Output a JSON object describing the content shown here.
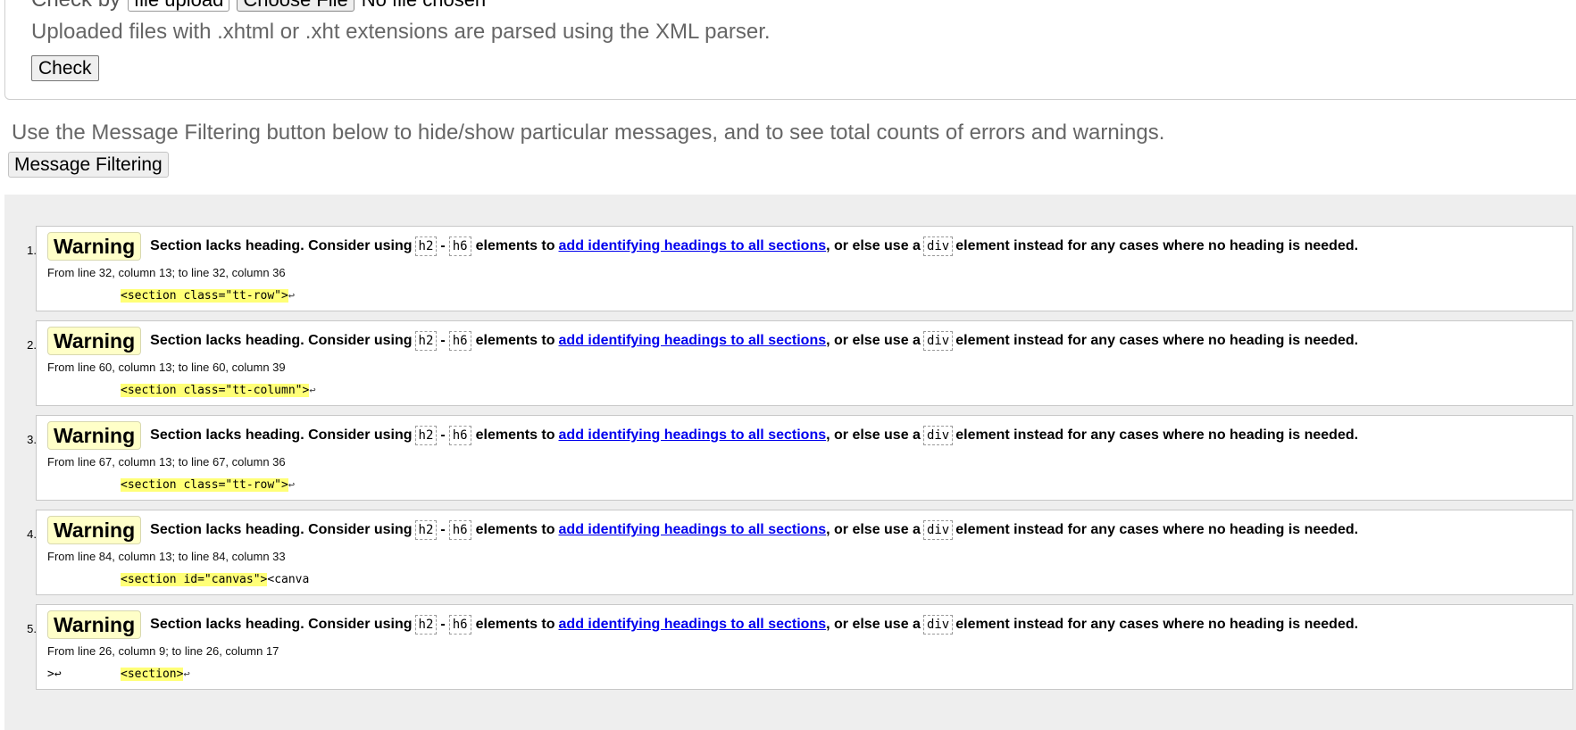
{
  "form": {
    "check_by_label": "Check by",
    "check_by_value": "file upload",
    "choose_file_label": "Choose File",
    "no_file_text": "No file chosen",
    "upload_note": "Uploaded files with .xhtml or .xht extensions are parsed using the XML parser.",
    "check_button": "Check"
  },
  "filter": {
    "note": "Use the Message Filtering button below to hide/show particular messages, and to see total counts of errors and warnings.",
    "button": "Message Filtering"
  },
  "message_text": {
    "prefix": "Section lacks heading. Consider using",
    "code_h2": "h2",
    "dash": "-",
    "code_h6": "h6",
    "middle": "elements to",
    "link": "add identifying headings to all sections",
    "after_link": ", or else use a",
    "code_div": "div",
    "suffix": "element instead for any cases where no heading is needed."
  },
  "messages": [
    {
      "num": "1.",
      "badge": "Warning",
      "location": "From line 32, column 13; to line 32, column 36",
      "pre": "",
      "highlight": "<section class=\"tt-row\">",
      "post": "",
      "lf": "↩"
    },
    {
      "num": "2.",
      "badge": "Warning",
      "location": "From line 60, column 13; to line 60, column 39",
      "pre": "",
      "highlight": "<section class=\"tt-column\">",
      "post": "",
      "lf": "↩"
    },
    {
      "num": "3.",
      "badge": "Warning",
      "location": "From line 67, column 13; to line 67, column 36",
      "pre": "",
      "highlight": "<section class=\"tt-row\">",
      "post": "",
      "lf": "↩"
    },
    {
      "num": "4.",
      "badge": "Warning",
      "location": "From line 84, column 13; to line 84, column 33",
      "pre": "",
      "highlight": "<section id=\"canvas\">",
      "post": "<canva",
      "lf": ""
    },
    {
      "num": "5.",
      "badge": "Warning",
      "location": "From line 26, column 9; to line 26, column 17",
      "pre": ">↩",
      "highlight": "<section>",
      "post": "",
      "lf": "↩"
    }
  ]
}
